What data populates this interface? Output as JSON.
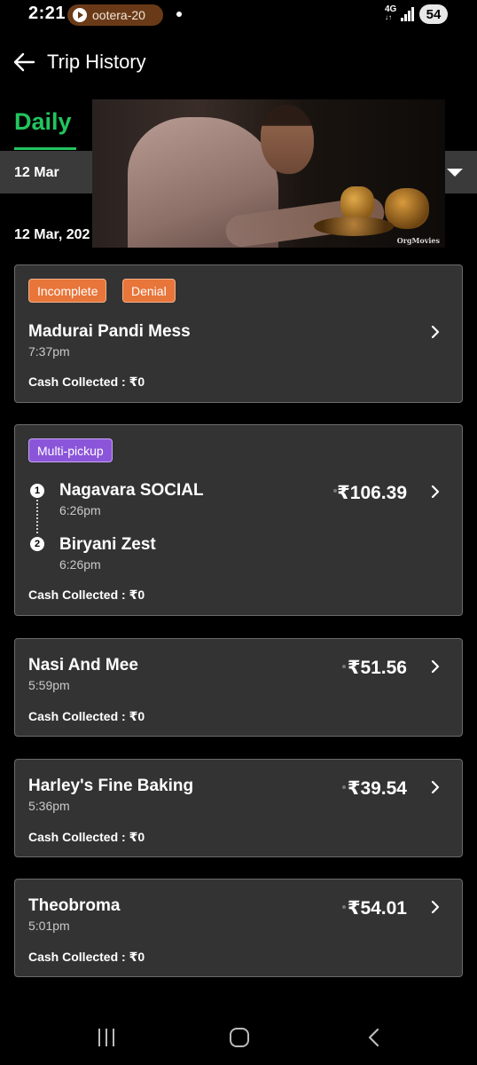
{
  "status_bar": {
    "time": "2:21",
    "media_text": "ootera-20",
    "network": "4G",
    "battery": "54"
  },
  "header": {
    "title": "Trip History"
  },
  "tabs": {
    "active": "Daily"
  },
  "date_selector": {
    "value": "12 Mar"
  },
  "date_heading": "12 Mar, 202",
  "video_overlay": {
    "watermark": "OrgMovies"
  },
  "trips": [
    {
      "badges": [
        "Incomplete",
        "Denial"
      ],
      "restaurant": "Madurai Pandi Mess",
      "time": "7:37pm",
      "amount": "",
      "cash": "Cash Collected : ₹0"
    },
    {
      "badges": [
        "Multi-pickup"
      ],
      "stops": [
        {
          "num": "1",
          "name": "Nagavara SOCIAL",
          "time": "6:26pm"
        },
        {
          "num": "2",
          "name": "Biryani Zest",
          "time": "6:26pm"
        }
      ],
      "amount": "₹106.39",
      "cash": "Cash Collected : ₹0"
    },
    {
      "restaurant": "Nasi And Mee",
      "time": "5:59pm",
      "amount": "₹51.56",
      "cash": "Cash Collected : ₹0"
    },
    {
      "restaurant": "Harley's Fine Baking",
      "time": "5:36pm",
      "amount": "₹39.54",
      "cash": "Cash Collected : ₹0"
    },
    {
      "restaurant": "Theobroma",
      "time": "5:01pm",
      "amount": "₹54.01",
      "cash": "Cash Collected : ₹0"
    }
  ],
  "colors": {
    "accent_green": "#22c55e",
    "badge_orange": "#e8753a",
    "badge_purple": "#8b55d9",
    "card_bg": "#333333"
  },
  "icons": [
    "back-arrow-icon",
    "caret-down-icon",
    "chevron-right-icon",
    "play-icon",
    "signal-icon",
    "recent-apps-icon",
    "home-icon",
    "nav-back-icon"
  ]
}
